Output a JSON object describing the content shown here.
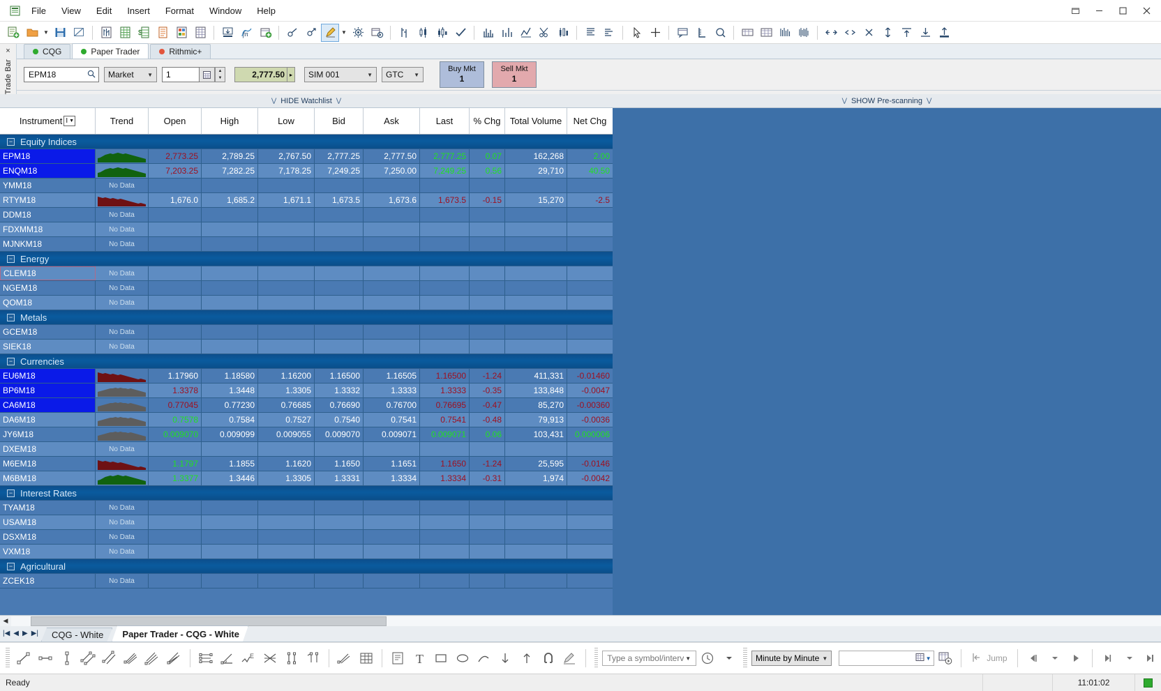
{
  "window": {
    "controls": [
      "restore-down",
      "minimize",
      "maximize",
      "close"
    ]
  },
  "menu": {
    "items": [
      "File",
      "View",
      "Edit",
      "Insert",
      "Format",
      "Window",
      "Help"
    ]
  },
  "tradebar": {
    "panel_title": "Trade Bar",
    "close_label": "×",
    "account_tabs": [
      {
        "label": "CQG",
        "status_color": "#2eaa2e",
        "selected": false
      },
      {
        "label": "Paper Trader",
        "status_color": "#2eaa2e",
        "selected": true
      },
      {
        "label": "Rithmic+",
        "status_color": "#e2553d",
        "selected": false
      }
    ],
    "symbol_value": "EPM18",
    "symbol_placeholder": "",
    "order_type": "Market",
    "quantity": "1",
    "price": "2,777.50",
    "account": "SIM 001",
    "tif": "GTC",
    "buy_button": {
      "line1": "Buy Mkt",
      "line2": "1"
    },
    "sell_button": {
      "line1": "Sell Mkt",
      "line2": "1"
    }
  },
  "collapse_bars": {
    "hide_watchlist": "HIDE Watchlist",
    "show_prescanning": "SHOW Pre-scanning",
    "chevron": "⋁"
  },
  "watchlist": {
    "columns": [
      "Instrument",
      "Trend",
      "Open",
      "High",
      "Low",
      "Bid",
      "Ask",
      "Last",
      "% Chg",
      "Total Volume",
      "Net Chg"
    ],
    "filter_label": "I",
    "no_data_label": "No Data",
    "groups": [
      {
        "name": "Equity Indices",
        "rows": [
          {
            "instrument": "EPM18",
            "selected": true,
            "trend": "up",
            "open": "2,773.25",
            "open_dir": "down",
            "high": "2,789.25",
            "low": "2,767.50",
            "bid": "2,777.25",
            "ask": "2,777.50",
            "last": "2,777.25",
            "last_dir": "up",
            "chg": "0.07",
            "chg_dir": "up",
            "volume": "162,268",
            "net": "2.00",
            "net_dir": "up"
          },
          {
            "instrument": "ENQM18",
            "selected": true,
            "trend": "up",
            "open": "7,203.25",
            "open_dir": "down",
            "high": "7,282.25",
            "low": "7,178.25",
            "bid": "7,249.25",
            "ask": "7,250.00",
            "last": "7,249.25",
            "last_dir": "up",
            "chg": "0.56",
            "chg_dir": "up",
            "volume": "29,710",
            "net": "40.50",
            "net_dir": "up"
          },
          {
            "instrument": "YMM18",
            "no_data": true
          },
          {
            "instrument": "RTYM18",
            "trend": "down",
            "open": "1,676.0",
            "high": "1,685.2",
            "low": "1,671.1",
            "bid": "1,673.5",
            "ask": "1,673.6",
            "last": "1,673.5",
            "last_dir": "down",
            "chg": "-0.15",
            "chg_dir": "down",
            "volume": "15,270",
            "net": "-2.5",
            "net_dir": "down"
          },
          {
            "instrument": "DDM18",
            "no_data": true
          },
          {
            "instrument": "FDXMM18",
            "no_data": true
          },
          {
            "instrument": "MJNKM18",
            "no_data": true
          }
        ]
      },
      {
        "name": "Energy",
        "rows": [
          {
            "instrument": "CLEM18",
            "no_data": true,
            "focused": true
          },
          {
            "instrument": "NGEM18",
            "no_data": true
          },
          {
            "instrument": "QOM18",
            "no_data": true
          }
        ]
      },
      {
        "name": "Metals",
        "rows": [
          {
            "instrument": "GCEM18",
            "no_data": true
          },
          {
            "instrument": "SIEK18",
            "no_data": true
          }
        ]
      },
      {
        "name": "Currencies",
        "rows": [
          {
            "instrument": "EU6M18",
            "selected": true,
            "trend": "down",
            "open": "1.17960",
            "high": "1.18580",
            "low": "1.16200",
            "bid": "1.16500",
            "ask": "1.16505",
            "last": "1.16500",
            "last_dir": "down",
            "chg": "-1.24",
            "chg_dir": "down",
            "volume": "411,331",
            "net": "-0.01460",
            "net_dir": "down"
          },
          {
            "instrument": "BP6M18",
            "selected": true,
            "trend": "flat",
            "open": "1.3378",
            "open_dir": "down",
            "high": "1.3448",
            "low": "1.3305",
            "bid": "1.3332",
            "ask": "1.3333",
            "last": "1.3333",
            "last_dir": "down",
            "chg": "-0.35",
            "chg_dir": "down",
            "volume": "133,848",
            "net": "-0.0047",
            "net_dir": "down"
          },
          {
            "instrument": "CA6M18",
            "selected": true,
            "trend": "flat",
            "open": "0.77045",
            "open_dir": "down",
            "high": "0.77230",
            "low": "0.76685",
            "bid": "0.76690",
            "ask": "0.76700",
            "last": "0.76695",
            "last_dir": "down",
            "chg": "-0.47",
            "chg_dir": "down",
            "volume": "85,270",
            "net": "-0.00360",
            "net_dir": "down"
          },
          {
            "instrument": "DA6M18",
            "trend": "flat",
            "open": "0.7578",
            "open_dir": "up",
            "high": "0.7584",
            "low": "0.7527",
            "bid": "0.7540",
            "ask": "0.7541",
            "last": "0.7541",
            "last_dir": "down",
            "chg": "-0.48",
            "chg_dir": "down",
            "volume": "79,913",
            "net": "-0.0036",
            "net_dir": "down"
          },
          {
            "instrument": "JY6M18",
            "trend": "flat",
            "open": "0.009070",
            "open_dir": "up",
            "high": "0.009099",
            "low": "0.009055",
            "bid": "0.009070",
            "ask": "0.009071",
            "last": "0.009071",
            "last_dir": "up",
            "chg": "0.06",
            "chg_dir": "up",
            "volume": "103,431",
            "net": "0.000006",
            "net_dir": "up"
          },
          {
            "instrument": "DXEM18",
            "no_data": true
          },
          {
            "instrument": "M6EM18",
            "trend": "down",
            "open": "1.1797",
            "open_dir": "up",
            "high": "1.1855",
            "low": "1.1620",
            "bid": "1.1650",
            "ask": "1.1651",
            "last": "1.1650",
            "last_dir": "down",
            "chg": "-1.24",
            "chg_dir": "down",
            "volume": "25,595",
            "net": "-0.0146",
            "net_dir": "down"
          },
          {
            "instrument": "M6BM18",
            "trend": "up",
            "open": "1.3377",
            "open_dir": "up",
            "high": "1.3446",
            "low": "1.3305",
            "bid": "1.3331",
            "ask": "1.3334",
            "last": "1.3334",
            "last_dir": "down",
            "chg": "-0.31",
            "chg_dir": "down",
            "volume": "1,974",
            "net": "-0.0042",
            "net_dir": "down"
          }
        ]
      },
      {
        "name": "Interest Rates",
        "rows": [
          {
            "instrument": "TYAM18",
            "no_data": true
          },
          {
            "instrument": "USAM18",
            "no_data": true
          },
          {
            "instrument": "DSXM18",
            "no_data": true
          },
          {
            "instrument": "VXM18",
            "no_data": true
          }
        ]
      },
      {
        "name": "Agricultural",
        "rows": [
          {
            "instrument": "ZCEK18",
            "no_data": true
          }
        ]
      }
    ]
  },
  "chart_tabs": {
    "tabs": [
      {
        "label": "CQG - White",
        "selected": false
      },
      {
        "label": "Paper Trader - CQG - White",
        "selected": true
      }
    ]
  },
  "drawbar": {
    "symbol_interval_placeholder": "Type a symbol/interval",
    "symbol_interval_value": "",
    "interval": "Minute by Minute",
    "blank_value": "",
    "jump_label": "Jump"
  },
  "statusbar": {
    "message": "Ready",
    "time": "11:01:02"
  }
}
